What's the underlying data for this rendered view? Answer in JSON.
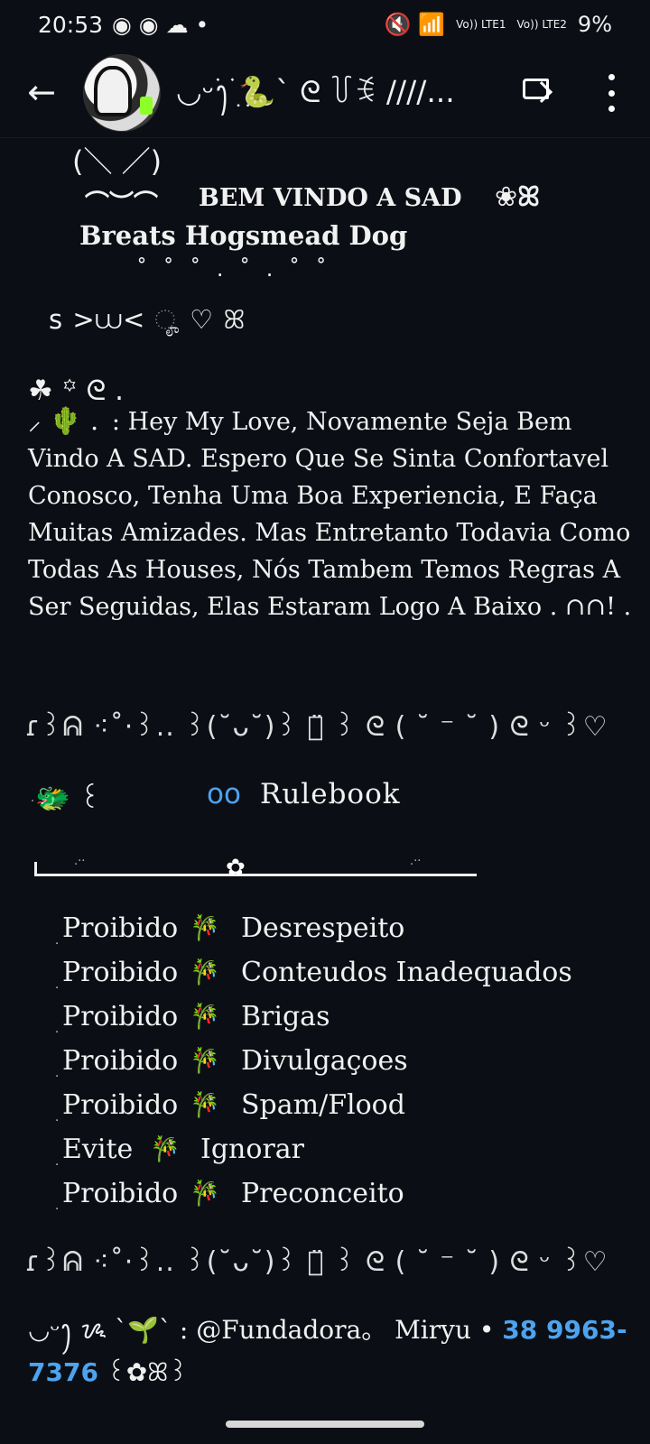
{
  "status_bar": {
    "time": "20:53",
    "left_icons": "◉ ◉ ☁ •",
    "right_icons": "🔇 📶",
    "lte1": "Vo)) LTE1",
    "lte2": "Vo)) LTE2",
    "battery": "9%"
  },
  "app_bar": {
    "title": "◡ᵕ࣪ꫂִ࣪ ִ🐍ˋ ᘓ ꒦ꉂ ////...",
    "back_icon": "←"
  },
  "message": {
    "ears": "(＼      ／)",
    "welcome_prefix": "⌒︶⌒",
    "welcome_title": "BEM VINDO A SAD",
    "welcome_suffix": "❀ꕤ",
    "welcome_subtitle": "Breats Hogsmead Dog",
    "dots": "˚  ˚   ˚  .   ˚   .  ˚  ˚",
    "faces": "ꜱ >⩊< ೄ    ♡    ꕤ",
    "clover_line": "☘︎ ꙳   ᘓ .",
    "greeting_lead": "⸝  🌵 .",
    "body": ": Hey My Love, Novamente Seja Bem Vindo A SAD. Espero Que Se Sinta Confortavel Conosco, Tenha Uma Boa Experiencia, E Faça Muitas Amizades. Mas Entretanto Todavia Como Todas As Houses, Nós Tambem Temos Regras A Ser Seguidas, Elas Estaram Logo A Baixo . ∩∩! .",
    "divider": "ɾ꒱ᕱ ⁖˚·꒱.. ꒱(˘ᴗ˘)꒱ ⌒̈ ꒱ ᘓ ( ˘ ⁻ ˘ ) ᘓ ᵕ ꒱♡",
    "rulebook_prefix": "🐲 ꒰",
    "rulebook_num": "oo",
    "rulebook_title": "Rulebook",
    "divider_flower": "✿",
    "rules": [
      {
        "prefix": "Proibido",
        "icon": "🎋",
        "text": "Desrespeito"
      },
      {
        "prefix": "Proibido",
        "icon": "🎋",
        "text": "Conteudos Inadequados"
      },
      {
        "prefix": "Proibido",
        "icon": "🎋",
        "text": "Brigas"
      },
      {
        "prefix": "Proibido",
        "icon": "🎋",
        "text": "Divulgaçoes"
      },
      {
        "prefix": "Proibido",
        "icon": "🎋",
        "text": "Spam/Flood"
      },
      {
        "prefix": "Evite",
        "icon": "🎋",
        "text": "Ignorar"
      },
      {
        "prefix": "Proibido",
        "icon": "🎋",
        "text": "Preconceito"
      }
    ],
    "footer_prefix": "◡ᵕꫂ ᝰ ˋ🌱ˋ : @Fundadora。 Miryu •",
    "phone": "38 9963-7376",
    "footer_suffix": "꒰✿ꕤ꒱"
  },
  "colors": {
    "background": "#0b0f15",
    "text": "#f1f1f1",
    "accent_blue": "#4ea3ef"
  }
}
